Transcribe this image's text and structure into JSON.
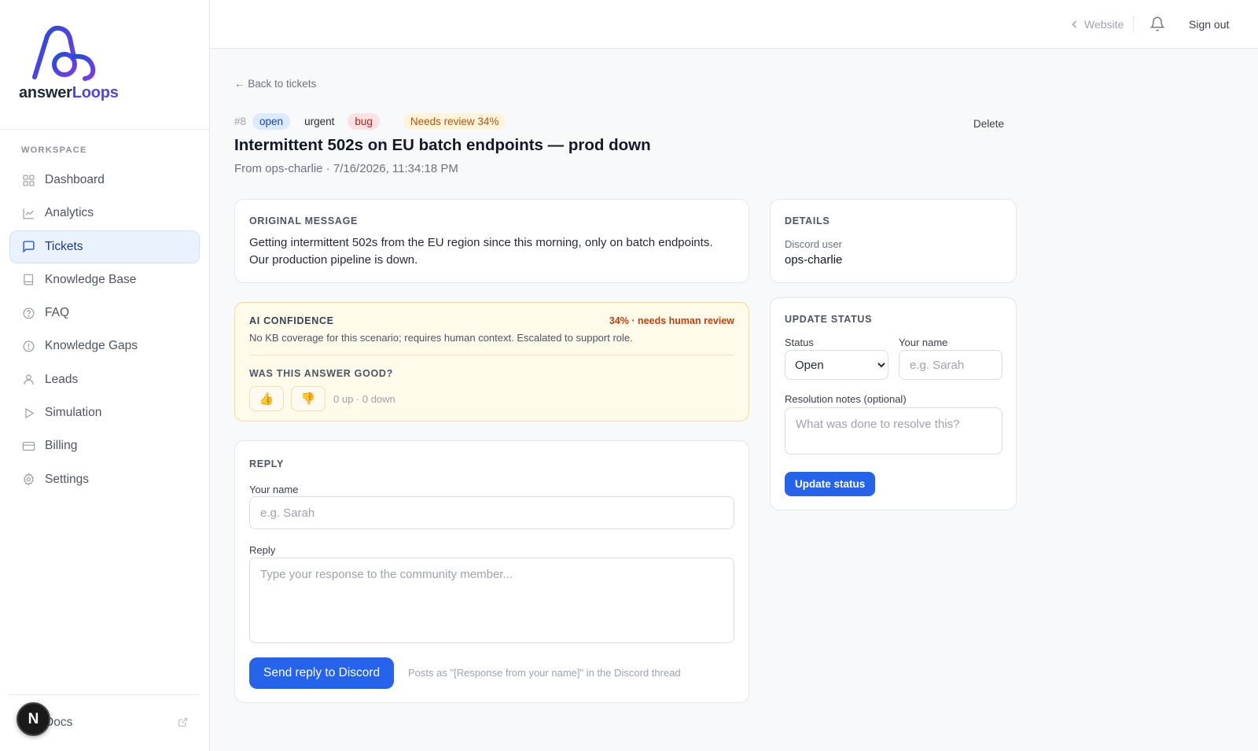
{
  "brand": {
    "name_part1": "answer",
    "name_part2": "Loops",
    "colors": {
      "primary": "#2563eb",
      "logo_gradient_start": "#1d4ed8",
      "logo_gradient_end": "#7c3aed"
    }
  },
  "sidebar": {
    "section_label": "WORKSPACE",
    "items": [
      {
        "label": "Dashboard",
        "icon": "grid-icon"
      },
      {
        "label": "Analytics",
        "icon": "chart-line-icon"
      },
      {
        "label": "Tickets",
        "icon": "message-square-icon",
        "active": true
      },
      {
        "label": "Knowledge Base",
        "icon": "book-icon"
      },
      {
        "label": "FAQ",
        "icon": "help-circle-icon"
      },
      {
        "label": "Knowledge Gaps",
        "icon": "alert-circle-icon"
      },
      {
        "label": "Leads",
        "icon": "user-icon"
      },
      {
        "label": "Simulation",
        "icon": "play-icon"
      },
      {
        "label": "Billing",
        "icon": "credit-card-icon"
      },
      {
        "label": "Settings",
        "icon": "gear-icon"
      }
    ],
    "footer": {
      "docs_label": "Docs",
      "badge": "N"
    }
  },
  "topbar": {
    "website_label": "Website",
    "signout_label": "Sign out"
  },
  "ticket": {
    "back_label": "← Back to tickets",
    "number": "#8",
    "status": "open",
    "priority": "urgent",
    "type": "bug",
    "review_badge": "Needs review 34%",
    "delete_label": "Delete",
    "title": "Intermittent 502s on EU batch endpoints — prod down",
    "from": "From ops-charlie · 7/16/2026, 11:34:18 PM"
  },
  "original_message": {
    "label": "ORIGINAL MESSAGE",
    "text": "Getting intermittent 502s from the EU region since this morning, only on batch endpoints. Our production pipeline is down."
  },
  "ai_confidence": {
    "label": "AI CONFIDENCE",
    "score": "34% · needs human review",
    "confidence_value": 34,
    "note": "No KB coverage for this scenario; requires human context. Escalated to support role.",
    "question": "WAS THIS ANSWER GOOD?",
    "thumbs_up": "👍",
    "thumbs_down": "👎",
    "votes": "0 up · 0 down"
  },
  "reply": {
    "label": "REPLY",
    "name_label": "Your name",
    "name_placeholder": "e.g. Sarah",
    "reply_label": "Reply",
    "reply_placeholder": "Type your response to the community member...",
    "send_label": "Send reply to Discord",
    "hint": "Posts as \"[Response from your name]\" in the Discord thread"
  },
  "details": {
    "label": "DETAILS",
    "key": "Discord user",
    "value": "ops-charlie"
  },
  "update_status": {
    "label": "UPDATE STATUS",
    "status_label": "Status",
    "status_value": "Open",
    "name_label": "Your name",
    "name_placeholder": "e.g. Sarah",
    "notes_label": "Resolution notes (optional)",
    "notes_placeholder": "What was done to resolve this?",
    "button_label": "Update status"
  }
}
